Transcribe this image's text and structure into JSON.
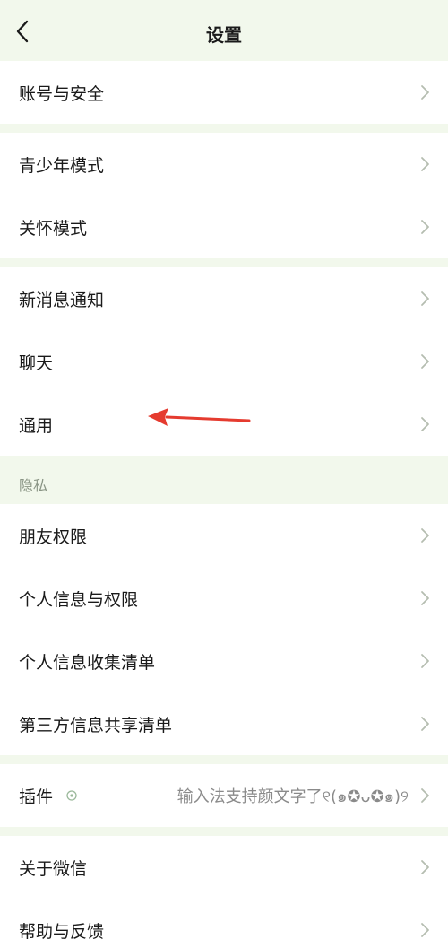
{
  "header": {
    "title": "设置"
  },
  "groups": {
    "account": {
      "items": [
        "账号与安全"
      ]
    },
    "modes": {
      "items": [
        "青少年模式",
        "关怀模式"
      ]
    },
    "messages": {
      "items": [
        "新消息通知",
        "聊天",
        "通用"
      ]
    },
    "privacy": {
      "header": "隐私",
      "items": [
        "朋友权限",
        "个人信息与权限",
        "个人信息收集清单",
        "第三方信息共享清单"
      ]
    },
    "plugins": {
      "label": "插件",
      "description": "输入法支持颜文字了୧(๑✪ᴗ✪๑)୨"
    },
    "about": {
      "items": [
        "关于微信",
        "帮助与反馈"
      ]
    }
  },
  "icons": {
    "back": "back-chevron-icon",
    "chevron": "chevron-right-icon",
    "plugin": "plugin-badge-icon"
  },
  "colors": {
    "background": "#f2f8ec",
    "card": "#ffffff",
    "chevron": "#b5bdb0",
    "annotation_arrow": "#e53b2f"
  }
}
